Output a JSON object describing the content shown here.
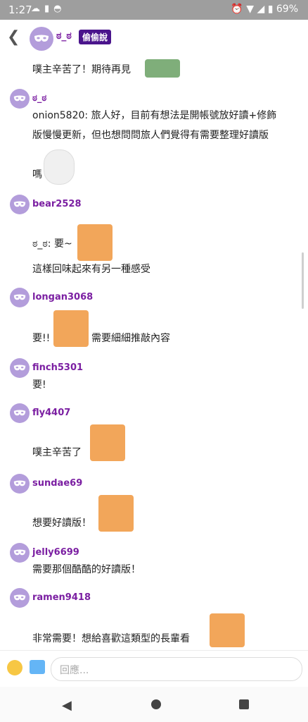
{
  "status_bar": {
    "time": "1:27",
    "left_icons": [
      "cloud-icon",
      "download-icon",
      "incognito-icon"
    ],
    "right_icons": [
      "alarm-icon",
      "wifi-icon",
      "signal-icon"
    ],
    "battery": "69%"
  },
  "header": {
    "name": "ಠ_ಠ",
    "badge": "偷偷說"
  },
  "posts": [
    {
      "name": "",
      "lines": [
        "噗主辛苦了！期待再見"
      ]
    },
    {
      "name": "ಠ_ಠ",
      "lines": [
        "onion5820: 旅人好，目前有想法是開帳號放好讀+修飾",
        "版慢慢更新，但也想問問旅人們覺得有需要整理好讀版",
        "嗎"
      ]
    },
    {
      "name": "bear2528",
      "lines": [
        "ಠ_ಠ: 要~",
        "這樣回味起來有另一種感受"
      ]
    },
    {
      "name": "longan3068",
      "lines": [
        "要!!",
        "需要細細推敲內容"
      ]
    },
    {
      "name": "finch5301",
      "lines": [
        "要!"
      ]
    },
    {
      "name": "fly4407",
      "lines": [
        "噗主辛苦了"
      ]
    },
    {
      "name": "sundae69",
      "lines": [
        "想要好讀版！"
      ]
    },
    {
      "name": "jelly6699",
      "lines": [
        "需要那個酷酷的好讀版！"
      ]
    },
    {
      "name": "ramen9418",
      "lines": [
        "非常需要！想給喜歡這類型的長輩看"
      ]
    }
  ],
  "input": {
    "placeholder": "回應..."
  },
  "colors": {
    "accent": "#7b1fa2",
    "avatar": "#b39ddb",
    "badge": "#4a148c"
  }
}
